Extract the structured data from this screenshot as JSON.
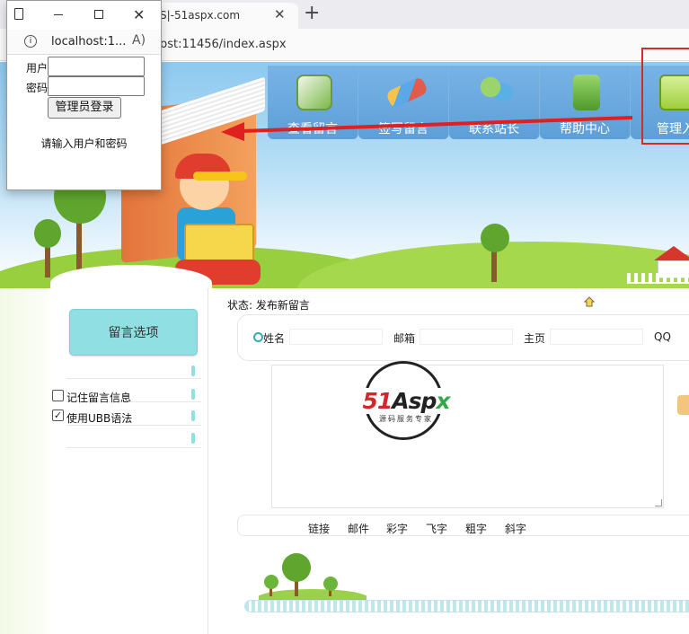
{
  "browser": {
    "tab_title": "S|-51aspx.com",
    "tab_close": "✕",
    "new_tab": "+",
    "address": "host:11456/index.aspx"
  },
  "nav": {
    "items": [
      {
        "label": "查看留言",
        "icon": "open-book-icon"
      },
      {
        "label": "签写留言",
        "icon": "pencils-icon"
      },
      {
        "label": "联系站长",
        "icon": "people-icon"
      },
      {
        "label": "帮助中心",
        "icon": "help-box-icon"
      },
      {
        "label": "管理入",
        "icon": "monitor-icon"
      }
    ]
  },
  "sidebar": {
    "options_title": "留言选项",
    "remember_label": "记住留言信息",
    "remember_checked": false,
    "ubb_label": "使用UBB语法",
    "ubb_checked": true,
    "check_mark": "✓"
  },
  "content": {
    "status": "状态: 发布新留言",
    "fields": {
      "name_label": "姓名",
      "email_label": "邮箱",
      "homepage_label": "主页",
      "qq_label": "QQ"
    },
    "logo": {
      "prefix": "51",
      "main": "Asp",
      "suffix": "x",
      "tagline": "源码服务专家"
    },
    "toolbar": [
      "链接",
      "邮件",
      "彩字",
      "飞字",
      "粗字",
      "斜字"
    ]
  },
  "popup": {
    "url": "localhost:1...",
    "info_glyph": "i",
    "read_glyph": "A)",
    "close_glyph": "✕",
    "user_label": "用户",
    "password_label": "密码",
    "login_button": "管理员登录",
    "message": "请输入用户和密码"
  },
  "colors": {
    "accent_teal": "#8fdfe3",
    "highlight_red": "#d62a2a",
    "nav_blue": "#5e9fd8"
  }
}
